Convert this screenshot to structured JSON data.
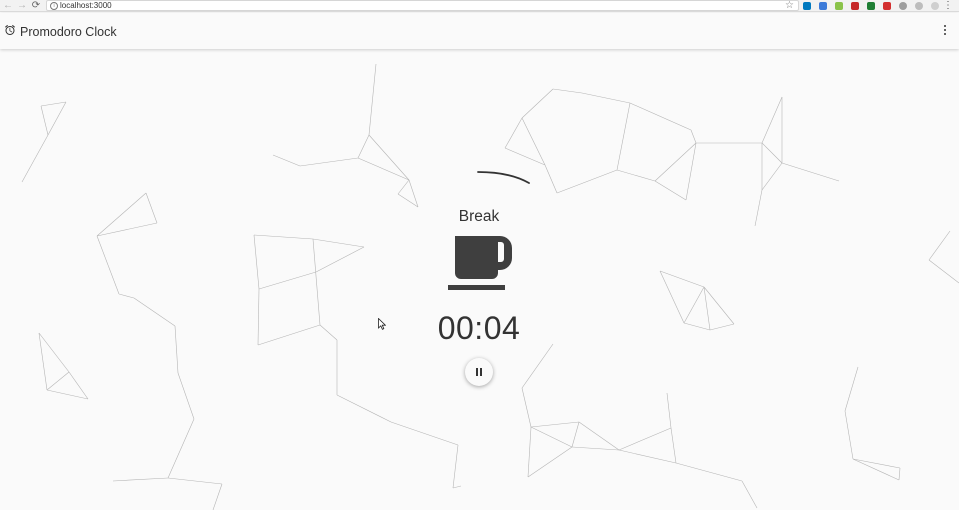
{
  "browser": {
    "url": "localhost:3000",
    "back_glyph": "←",
    "forward_glyph": "→",
    "reload_glyph": "⟳",
    "info_glyph": "i",
    "star_glyph": "☆",
    "menu_glyph": "⋮",
    "extension_icons": [
      {
        "name": "trello-extension-icon",
        "color": "#0079bf"
      },
      {
        "name": "grid-extension-icon",
        "color": "#3d7bd9"
      },
      {
        "name": "green-circle-extension-icon",
        "color": "#8bc34a"
      },
      {
        "name": "shield-extension-icon",
        "color": "#c62828"
      },
      {
        "name": "excel-extension-icon",
        "color": "#1e7e34"
      },
      {
        "name": "pdf-extension-icon",
        "color": "#d32f2f"
      },
      {
        "name": "a-circle-extension-icon",
        "color": "#9e9e9e"
      },
      {
        "name": "circle-outline-extension-icon",
        "color": "#bdbdbd"
      },
      {
        "name": "page-extension-icon",
        "color": "#cfcfcf"
      }
    ]
  },
  "app": {
    "title": "Promodoro Clock",
    "icon": "alarm-clock-icon",
    "menu_icon": "more-vert-icon"
  },
  "timer": {
    "mode": "Break",
    "mode_icon": "coffee-cup-icon",
    "time": "00:04",
    "control_icon": "pause-icon"
  },
  "colors": {
    "background": "#fafafa",
    "text": "#333333",
    "icon": "#3f3f3f",
    "particle_line": "#b5b5b5"
  }
}
